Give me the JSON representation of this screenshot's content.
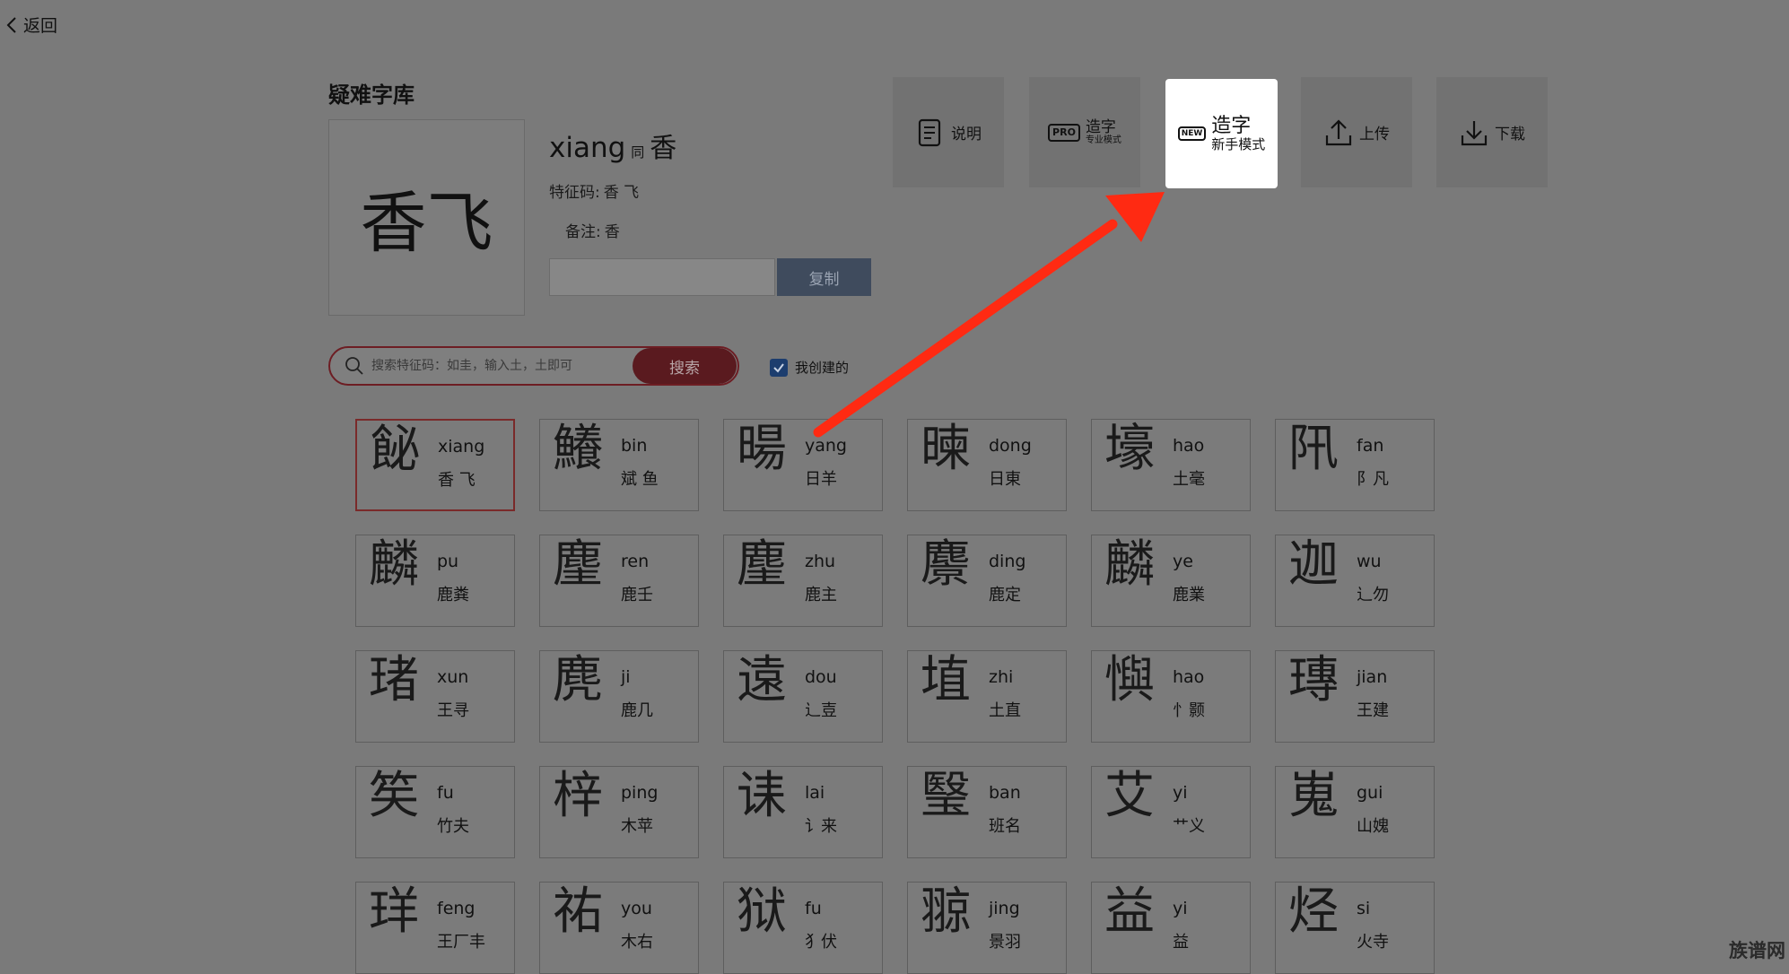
{
  "nav": {
    "back_label": "返回"
  },
  "library": {
    "title": "疑难字库"
  },
  "preview": {
    "glyph": "香飞",
    "pinyin": "xiang",
    "same_label": "同",
    "homophone": "香",
    "feature_label": "特征码:",
    "feature_value": "香 飞",
    "note_label": "备注:",
    "note_value": "香",
    "copy_input_value": "",
    "copy_label": "复制"
  },
  "toolbar": {
    "help_label": "说明",
    "pro_badge": "PRO",
    "pro_label": "造字",
    "pro_sub": "专业模式",
    "new_badge": "NEW",
    "new_label": "造字",
    "new_sub": "新手模式",
    "upload_label": "上传",
    "download_label": "下载"
  },
  "search": {
    "placeholder": "搜索特征码：如圭，输入土，土即可",
    "button_label": "搜索",
    "mine_label": "我创建的",
    "mine_checked": true
  },
  "grid": [
    [
      {
        "glyph": "飶",
        "pinyin": "xiang",
        "parts": "香 飞",
        "selected": true
      },
      {
        "glyph": "鱶",
        "pinyin": "bin",
        "parts": "斌 鱼"
      },
      {
        "glyph": "暘",
        "pinyin": "yang",
        "parts": "日羊"
      },
      {
        "glyph": "暕",
        "pinyin": "dong",
        "parts": "日東"
      },
      {
        "glyph": "壕",
        "pinyin": "hao",
        "parts": "土毫"
      },
      {
        "glyph": "阠",
        "pinyin": "fan",
        "parts": "阝凡"
      }
    ],
    [
      {
        "glyph": "麟",
        "pinyin": "pu",
        "parts": "鹿粪"
      },
      {
        "glyph": "麈",
        "pinyin": "ren",
        "parts": "鹿壬"
      },
      {
        "glyph": "麈",
        "pinyin": "zhu",
        "parts": "鹿主"
      },
      {
        "glyph": "麖",
        "pinyin": "ding",
        "parts": "鹿定"
      },
      {
        "glyph": "麟",
        "pinyin": "ye",
        "parts": "鹿業"
      },
      {
        "glyph": "迦",
        "pinyin": "wu",
        "parts": "辶勿"
      }
    ],
    [
      {
        "glyph": "琽",
        "pinyin": "xun",
        "parts": "王寻"
      },
      {
        "glyph": "麂",
        "pinyin": "ji",
        "parts": "鹿几"
      },
      {
        "glyph": "遠",
        "pinyin": "dou",
        "parts": "辶壴"
      },
      {
        "glyph": "埴",
        "pinyin": "zhi",
        "parts": "土直"
      },
      {
        "glyph": "懙",
        "pinyin": "hao",
        "parts": "忄颢"
      },
      {
        "glyph": "瑼",
        "pinyin": "jian",
        "parts": "王建"
      }
    ],
    [
      {
        "glyph": "笶",
        "pinyin": "fu",
        "parts": "竹夫"
      },
      {
        "glyph": "梓",
        "pinyin": "ping",
        "parts": "木苹"
      },
      {
        "glyph": "诔",
        "pinyin": "lai",
        "parts": "讠来"
      },
      {
        "glyph": "瑿",
        "pinyin": "ban",
        "parts": "班名"
      },
      {
        "glyph": "艾",
        "pinyin": "yi",
        "parts": "艹义"
      },
      {
        "glyph": "嵬",
        "pinyin": "gui",
        "parts": "山媿"
      }
    ],
    [
      {
        "glyph": "珜",
        "pinyin": "feng",
        "parts": "王厂丰"
      },
      {
        "glyph": "祐",
        "pinyin": "you",
        "parts": "木右"
      },
      {
        "glyph": "狱",
        "pinyin": "fu",
        "parts": "犭伏"
      },
      {
        "glyph": "翞",
        "pinyin": "jing",
        "parts": "景羽"
      },
      {
        "glyph": "益",
        "pinyin": "yi",
        "parts": "益"
      },
      {
        "glyph": "烃",
        "pinyin": "si",
        "parts": "火寺"
      }
    ]
  ],
  "annotation": {
    "arrow_color": "#ff2a12"
  },
  "watermark": "族谱网"
}
